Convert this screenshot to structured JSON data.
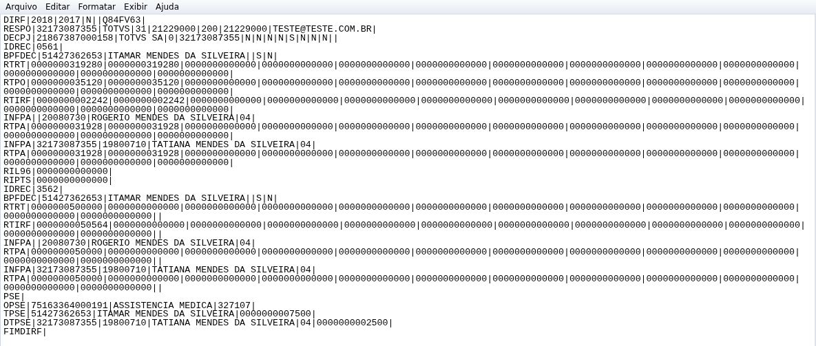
{
  "menu": [
    "Arquivo",
    "Editar",
    "Formatar",
    "Exibir",
    "Ajuda"
  ],
  "document": {
    "lines": [
      "DIRF|2018|2017|N||Q84FV63|",
      "RESPO|32173087355|TOTVS|31|21229000|200|21229000|TESTE@TESTE.COM.BR|",
      "DECPJ|21867387000158|TOTVS SA|0|32173087355|N|N|N|N|S|N|N|N||",
      "IDREC|0561|",
      "BPFDEC|51427362653|ITAMAR MENDES DA SILVEIRA||S|N|",
      "RTRT|0000000319280|0000000319280|0000000000000|0000000000000|0000000000000|0000000000000|0000000000000|0000000000000|0000000000000|0000000000000|",
      "0000000000000|0000000000000|0000000000000|",
      "RTPO|0000000035120|0000000035120|0000000000000|0000000000000|0000000000000|0000000000000|0000000000000|0000000000000|0000000000000|0000000000000|",
      "0000000000000|0000000000000|0000000000000|",
      "RTIRF|0000000002242|0000000002242|0000000000000|0000000000000|0000000000000|0000000000000|0000000000000|0000000000000|0000000000000|0000000000000|",
      "0000000000000|0000000000000|0000000000000|",
      "INFPA||20080730|ROGERIO MENDES DA SILVEIRA|04|",
      "RTPA|0000000031928|0000000031928|0000000000000|0000000000000|0000000000000|0000000000000|0000000000000|0000000000000|0000000000000|0000000000000|",
      "0000000000000|0000000000000|0000000000000|",
      "INFPA|32173087355|19800710|TATIANA MENDES DA SILVEIRA|04|",
      "RTPA|0000000031928|0000000031928|0000000000000|0000000000000|0000000000000|0000000000000|0000000000000|0000000000000|0000000000000|0000000000000|",
      "0000000000000|0000000000000|0000000000000|",
      "RIL96|0000000000000|",
      "RIPTS|0000000000000|",
      "IDREC|3562|",
      "BPFDEC|51427362653|ITAMAR MENDES DA SILVEIRA||S|N|",
      "RTRT|0000000500000|0000000000000|0000000000000|0000000000000|0000000000000|0000000000000|0000000000000|0000000000000|0000000000000|0000000000000|",
      "0000000000000|0000000000000||",
      "RTIRF|0000000050564|0000000000000|0000000000000|0000000000000|0000000000000|0000000000000|0000000000000|0000000000000|0000000000000|0000000000000|",
      "0000000000000|0000000000000||",
      "INFPA||20080730|ROGERIO MENDES DA SILVEIRA|04|",
      "RTPA|0000000050000|0000000000000|0000000000000|0000000000000|0000000000000|0000000000000|0000000000000|0000000000000|0000000000000|0000000000000|",
      "0000000000000|0000000000000||",
      "INFPA|32173087355|19800710|TATIANA MENDES DA SILVEIRA|04|",
      "RTPA|0000000050000|0000000000000|0000000000000|0000000000000|0000000000000|0000000000000|0000000000000|0000000000000|0000000000000|0000000000000|",
      "0000000000000|0000000000000||",
      "PSE|",
      "OPSE|75163364000191|ASSISTENCIA MEDICA|327107|",
      "TPSE|51427362653|ITAMAR MENDES DA SILVEIRA|0000000007500|",
      "DTPSE|32173087355|19800710|TATIANA MENDES DA SILVEIRA|04|0000000002500|",
      "FIMDIRF|"
    ]
  }
}
